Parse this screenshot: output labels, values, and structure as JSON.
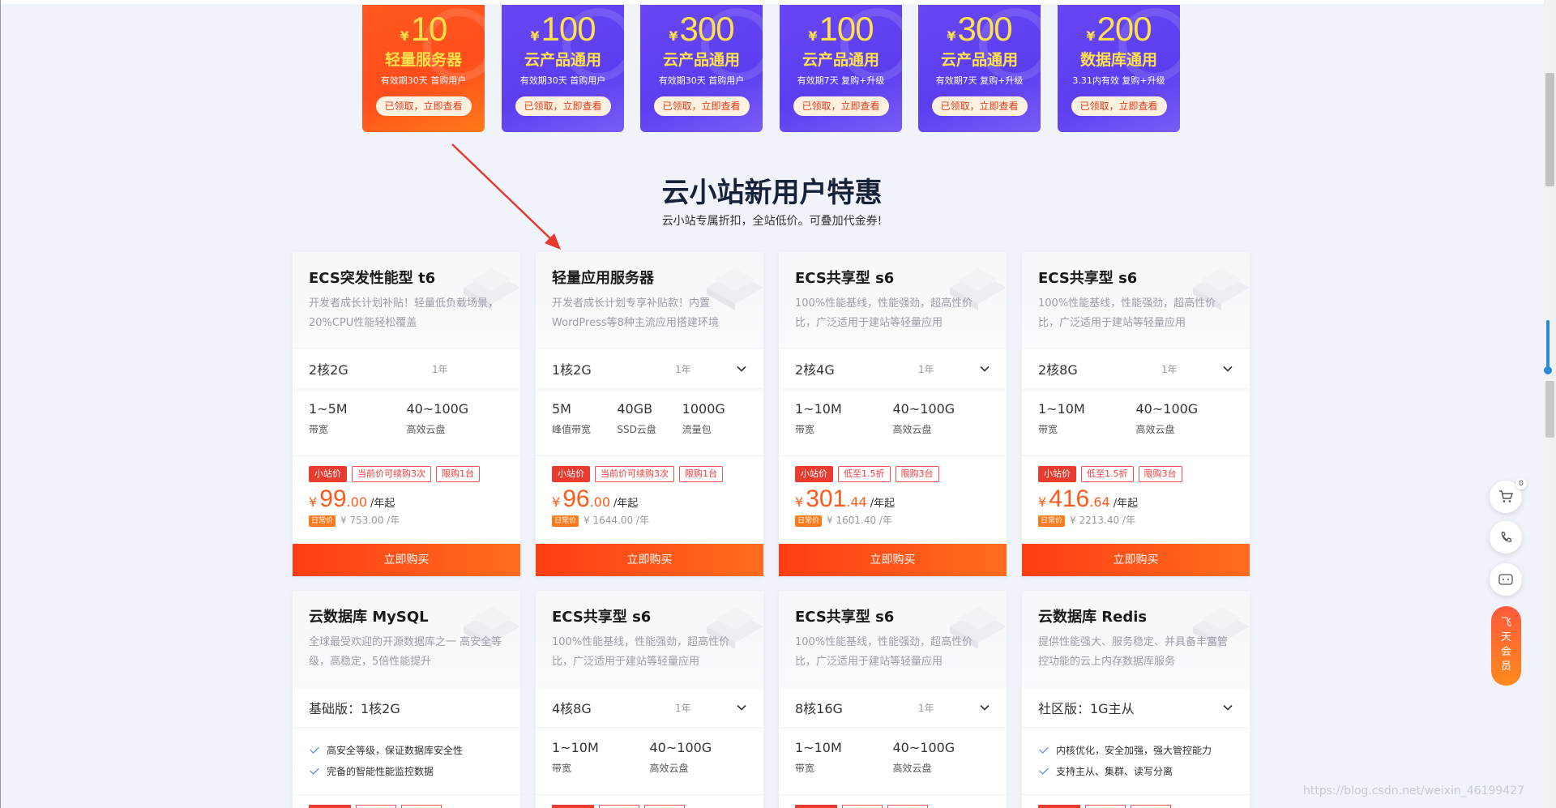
{
  "coupons": [
    {
      "amount": "10",
      "title": "轻量服务器",
      "desc": "有效期30天 首购用户",
      "btn": "已领取，立即查看",
      "color": "#ff4d1c"
    },
    {
      "amount": "100",
      "title": "云产品通用",
      "desc": "有效期30天 首购用户",
      "btn": "已领取，立即查看",
      "color": "#5b3ef0"
    },
    {
      "amount": "300",
      "title": "云产品通用",
      "desc": "有效期30天 首购用户",
      "btn": "已领取，立即查看",
      "color": "#5b3ef0"
    },
    {
      "amount": "100",
      "title": "云产品通用",
      "desc": "有效期7天 复购+升级",
      "btn": "已领取，立即查看",
      "color": "#5b3ef0"
    },
    {
      "amount": "300",
      "title": "云产品通用",
      "desc": "有效期7天 复购+升级",
      "btn": "已领取，立即查看",
      "color": "#5b3ef0"
    },
    {
      "amount": "200",
      "title": "数据库通用",
      "desc": "3.31内有效 复购+升级",
      "btn": "已领取，立即查看",
      "color": "#5b3ef0"
    }
  ],
  "currency": "¥",
  "section": {
    "title": "云小站新用户特惠",
    "subtitle": "云小站专属折扣，全站低价。可叠加代金券!"
  },
  "cards": [
    {
      "name": "ECS突发性能型 t6",
      "desc": "开发者成长计划补贴！轻量低负载场景，20%CPU性能轻松覆盖",
      "spec": "2核2G",
      "term": "1年",
      "has_dropdown": false,
      "metrics": [
        {
          "value": "1~5M",
          "label": "带宽"
        },
        {
          "value": "40~100G",
          "label": "高效云盘"
        }
      ],
      "tags": [
        "小站价",
        "当前价可续购3次",
        "限购1台"
      ],
      "price_int": "99",
      "price_dec": ".00",
      "price_unit": "/年起",
      "orig_tag": "日常价",
      "orig_price": "¥ 753.00 /年",
      "buy": "立即购买"
    },
    {
      "name": "轻量应用服务器",
      "desc": "开发者成长计划专享补贴款！内置WordPress等8种主流应用搭建环境",
      "spec": "1核2G",
      "term": "1年",
      "has_dropdown": true,
      "metrics": [
        {
          "value": "5M",
          "label": "峰值带宽"
        },
        {
          "value": "40GB",
          "label": "SSD云盘"
        },
        {
          "value": "1000G",
          "label": "流量包"
        }
      ],
      "tags": [
        "小站价",
        "当前价可续购3次",
        "限购1台"
      ],
      "price_int": "96",
      "price_dec": ".00",
      "price_unit": "/年起",
      "orig_tag": "日常价",
      "orig_price": "¥ 1644.00 /年",
      "buy": "立即购买"
    },
    {
      "name": "ECS共享型 s6",
      "desc": "100%性能基线，性能强劲，超高性价比，广泛适用于建站等轻量应用",
      "spec": "2核4G",
      "term": "1年",
      "has_dropdown": true,
      "metrics": [
        {
          "value": "1~10M",
          "label": "带宽"
        },
        {
          "value": "40~100G",
          "label": "高效云盘"
        }
      ],
      "tags": [
        "小站价",
        "低至1.5折",
        "限购3台"
      ],
      "price_int": "301",
      "price_dec": ".44",
      "price_unit": "/年起",
      "orig_tag": "日常价",
      "orig_price": "¥ 1601.40 /年",
      "buy": "立即购买"
    },
    {
      "name": "ECS共享型 s6",
      "desc": "100%性能基线，性能强劲，超高性价比，广泛适用于建站等轻量应用",
      "spec": "2核8G",
      "term": "1年",
      "has_dropdown": true,
      "metrics": [
        {
          "value": "1~10M",
          "label": "带宽"
        },
        {
          "value": "40~100G",
          "label": "高效云盘"
        }
      ],
      "tags": [
        "小站价",
        "低至1.5折",
        "限购3台"
      ],
      "price_int": "416",
      "price_dec": ".64",
      "price_unit": "/年起",
      "orig_tag": "日常价",
      "orig_price": "¥ 2213.40 /年",
      "buy": "立即购买"
    },
    {
      "name": "云数据库 MySQL",
      "desc": "全球最受欢迎的开源数据库之一 高安全等级，高稳定，5倍性能提升",
      "spec": "基础版：1核2G",
      "term": "",
      "has_dropdown": false,
      "features": [
        "高安全等级，保证数据库安全性",
        "完备的智能性能监控数据"
      ]
    },
    {
      "name": "ECS共享型 s6",
      "desc": "100%性能基线，性能强劲，超高性价比，广泛适用于建站等轻量应用",
      "spec": "4核8G",
      "term": "1年",
      "has_dropdown": true,
      "metrics": [
        {
          "value": "1~10M",
          "label": "带宽"
        },
        {
          "value": "40~100G",
          "label": "高效云盘"
        }
      ]
    },
    {
      "name": "ECS共享型 s6",
      "desc": "100%性能基线，性能强劲，超高性价比，广泛适用于建站等轻量应用",
      "spec": "8核16G",
      "term": "1年",
      "has_dropdown": true,
      "metrics": [
        {
          "value": "1~10M",
          "label": "带宽"
        },
        {
          "value": "40~100G",
          "label": "高效云盘"
        }
      ]
    },
    {
      "name": "云数据库 Redis",
      "desc": "提供性能强大、服务稳定、并具备丰富管控功能的云上内存数据库服务",
      "spec": "社区版：1G主从",
      "term": "",
      "has_dropdown": true,
      "features": [
        "内核优化，安全加强，强大管控能力",
        "支持主从、集群、读写分离"
      ]
    }
  ],
  "floating": {
    "cart_count": "0",
    "vip_label": "飞天会员"
  },
  "watermark": "https://blog.csdn.net/weixin_46199427",
  "accent_color": "#ff4d1c"
}
